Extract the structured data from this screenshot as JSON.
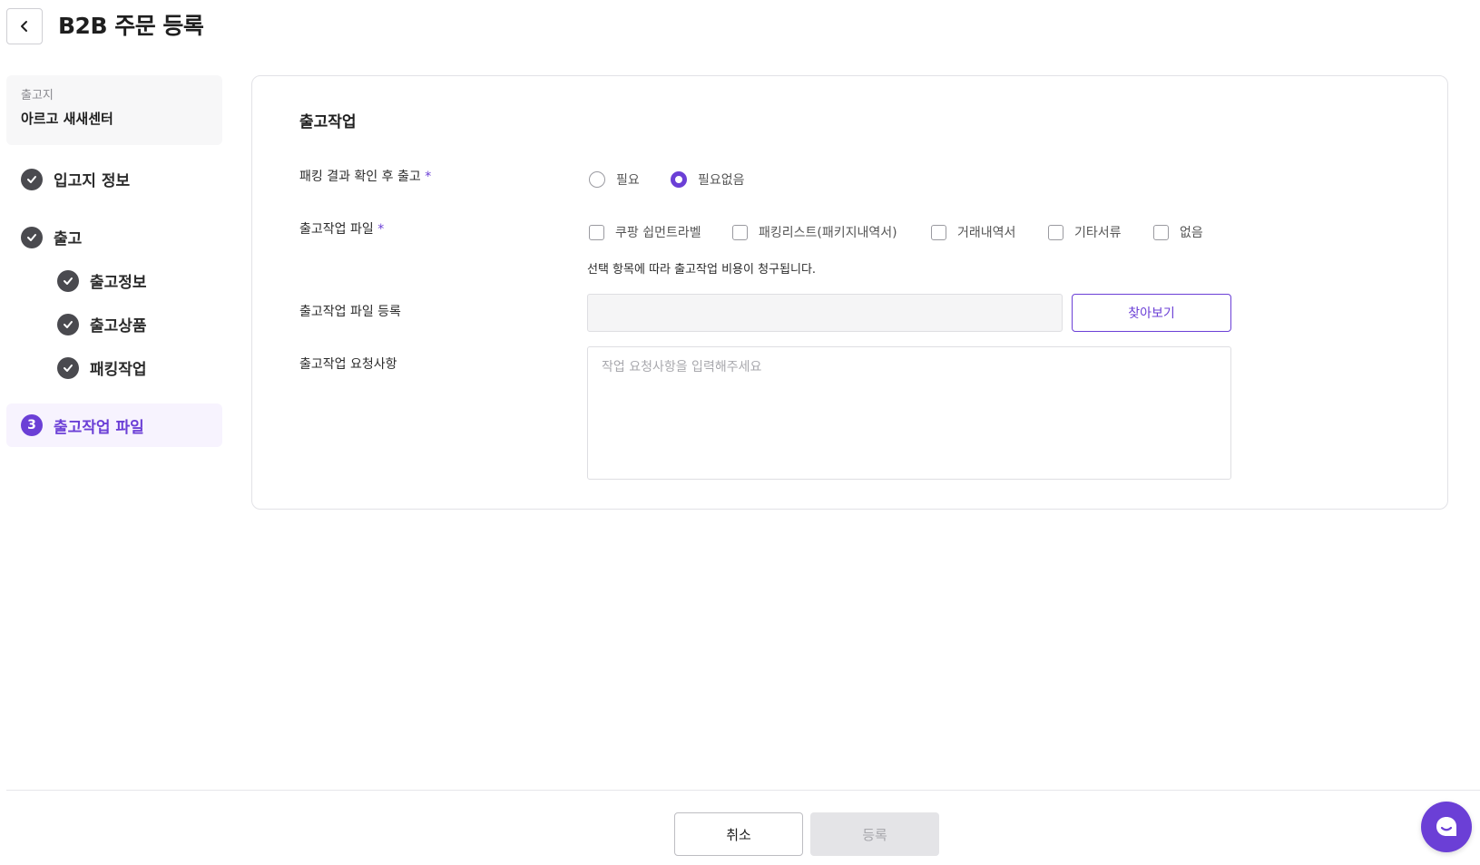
{
  "header": {
    "title": "B2B 주문 등록"
  },
  "sidebar": {
    "origin_label": "출고지",
    "origin_value": "아르고 새새센터",
    "steps": [
      {
        "label": "입고지 정보",
        "status": "done"
      },
      {
        "label": "출고",
        "status": "done"
      },
      {
        "label": "출고정보",
        "status": "done"
      },
      {
        "label": "출고상품",
        "status": "done"
      },
      {
        "label": "패킹작업",
        "status": "done"
      },
      {
        "label": "출고작업 파일",
        "status": "active",
        "number": "3"
      }
    ]
  },
  "form": {
    "section_title": "출고작업",
    "packing_confirm": {
      "label": "패킹 결과 확인 후 출고",
      "required_mark": "*",
      "options": [
        "필요",
        "필요없음"
      ],
      "selected": "필요없음"
    },
    "work_file": {
      "label": "출고작업 파일",
      "required_mark": "*",
      "options": [
        "쿠팡 쉽먼트라벨",
        "패킹리스트(패키지내역서)",
        "거래내역서",
        "기타서류",
        "없음"
      ],
      "hint": "선택 항목에 따라 출고작업 비용이 청구됩니다."
    },
    "file_upload": {
      "label": "출고작업 파일 등록",
      "button": "찾아보기"
    },
    "request": {
      "label": "출고작업 요청사항",
      "placeholder": "작업 요청사항을 입력해주세요"
    }
  },
  "footer": {
    "cancel": "취소",
    "submit": "등록"
  },
  "colors": {
    "accent": "#6b3fd6",
    "done_icon": "#4a4a4f"
  },
  "icons": {
    "back": "chevron-left-icon",
    "done": "check-icon",
    "chat": "chat-icon"
  }
}
